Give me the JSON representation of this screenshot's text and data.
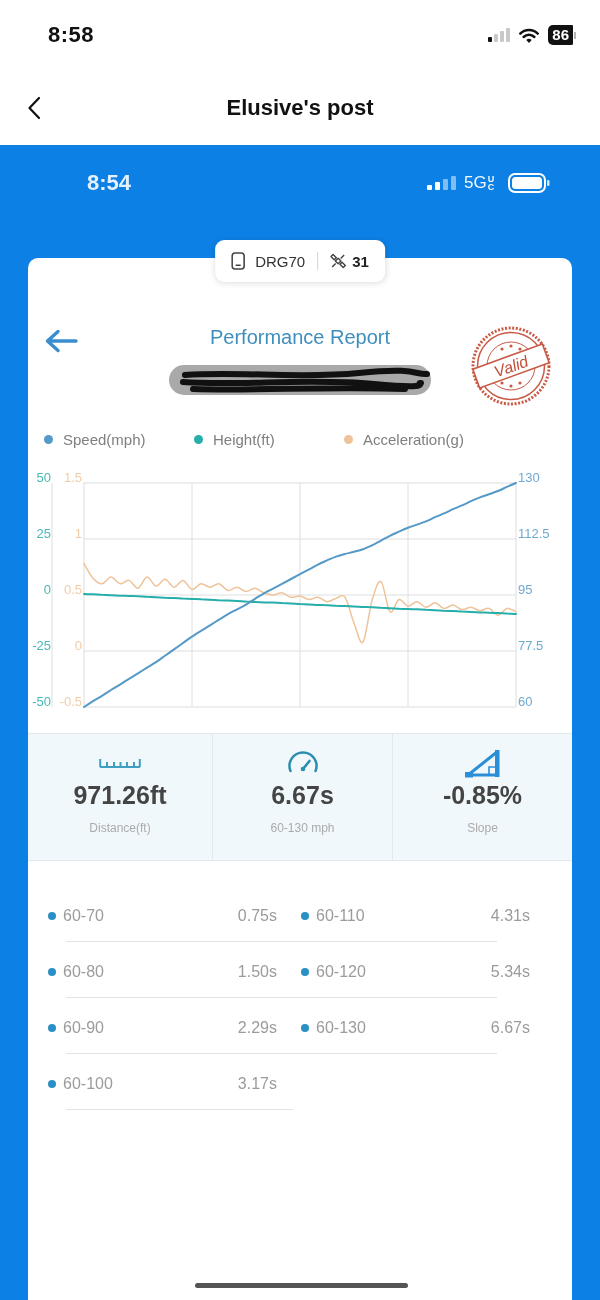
{
  "phone_status_bar": {
    "time": "8:58",
    "battery": "86"
  },
  "nav_bar": {
    "title": "Elusive's post"
  },
  "screenshot": {
    "status_bar": {
      "time": "8:54",
      "network": "5G",
      "network_badge": "UC"
    },
    "device_chip": {
      "device": "DRG70",
      "satellites": "31"
    },
    "report": {
      "title": "Performance Report",
      "stamp": "Valid",
      "chart_data": {
        "type": "line",
        "grid": true,
        "ylim": [
          -50,
          50
        ],
        "yticks": [
          -50,
          -25,
          0,
          25,
          50
        ],
        "y2lim": [
          60,
          130
        ],
        "y2ticks": [
          60,
          77.5,
          95,
          112.5,
          130
        ],
        "y3lim": [
          -0.5,
          1.5
        ],
        "y3ticks": [
          -0.5,
          0,
          0.5,
          1,
          1.5
        ],
        "series": [
          {
            "name": "Speed(mph)",
            "color": "#5499c7",
            "axis": "y2",
            "values": [
              60,
              61.8,
              63.5,
              65.3,
              67,
              68.8,
              70.5,
              72.3,
              74,
              76,
              78,
              80,
              82,
              83.8,
              85.5,
              87.3,
              89,
              90.5,
              92,
              93.8,
              95.5,
              97,
              98.5,
              100,
              101.5,
              103,
              104.5,
              105.8,
              107,
              107.8,
              108.5,
              109.3,
              110.5,
              112,
              113.5,
              114.8,
              116,
              117,
              118,
              119.3,
              120.5,
              121.8,
              123,
              124.3,
              125.5,
              126.5,
              127.5,
              128.8,
              130
            ]
          },
          {
            "name": "Height(ft)",
            "color": "#25aeaa",
            "values": [
              0.5,
              0.3,
              0.1,
              -0.1,
              -0.3,
              -0.4,
              -0.6,
              -0.8,
              -1,
              -1.2,
              -1.4,
              -1.6,
              -1.8,
              -1.9,
              -2.1,
              -2.3,
              -2.5,
              -2.7,
              -2.9,
              -3.1,
              -3.3,
              -3.4,
              -3.6,
              -3.8,
              -4,
              -4.2,
              -4.4,
              -4.6,
              -4.8,
              -4.9,
              -5.1,
              -5.3,
              -5.5,
              -5.7,
              -5.9,
              -6.1,
              -6.3,
              -6.4,
              -6.6,
              -6.8,
              -7,
              -7.2,
              -7.4,
              -7.6,
              -7.8,
              -7.9,
              -8.1,
              -8.3,
              -8.5
            ]
          },
          {
            "name": "Acceleration(g)",
            "color": "#eec39a",
            "axis": "y3",
            "values": [
              0.78,
              0.65,
              0.6,
              0.66,
              0.6,
              0.63,
              0.56,
              0.66,
              0.58,
              0.64,
              0.57,
              0.63,
              0.55,
              0.6,
              0.57,
              0.6,
              0.54,
              0.57,
              0.53,
              0.56,
              0.52,
              0.5,
              0.52,
              0.48,
              0.49,
              0.46,
              0.48,
              0.44,
              0.47,
              0.48,
              0.25,
              0.08,
              0.45,
              0.62,
              0.35,
              0.46,
              0.4,
              0.44,
              0.39,
              0.43,
              0.38,
              0.41,
              0.37,
              0.39,
              0.36,
              0.38,
              0.32,
              0.38,
              0.35
            ]
          }
        ]
      },
      "stats": [
        {
          "kind": "distance",
          "value": "971.26ft",
          "label": "Distance(ft)"
        },
        {
          "kind": "time",
          "value": "6.67s",
          "label": "60-130 mph"
        },
        {
          "kind": "slope",
          "value": "-0.85%",
          "label": "Slope"
        }
      ],
      "splits": [
        {
          "range": "60-70",
          "time": "0.75s"
        },
        {
          "range": "60-80",
          "time": "1.50s"
        },
        {
          "range": "60-90",
          "time": "2.29s"
        },
        {
          "range": "60-100",
          "time": "3.17s"
        },
        {
          "range": "60-110",
          "time": "4.31s"
        },
        {
          "range": "60-120",
          "time": "5.34s"
        },
        {
          "range": "60-130",
          "time": "6.67s"
        }
      ]
    }
  }
}
